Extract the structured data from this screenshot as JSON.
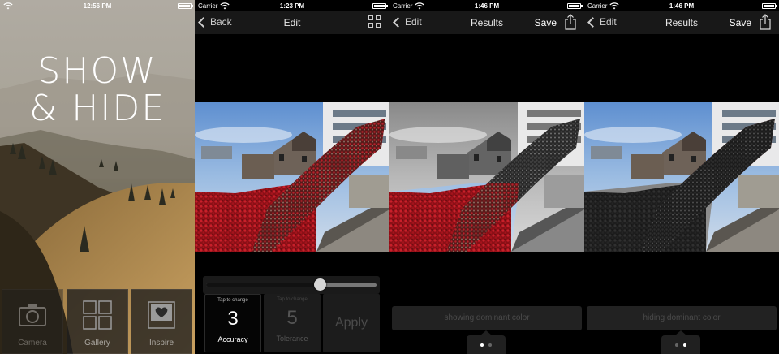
{
  "screens": {
    "home": {
      "status": {
        "carrier": "",
        "time": "12:56 PM"
      },
      "logo": {
        "line1": "SHOW",
        "line2": "& HIDE"
      },
      "tiles": [
        {
          "label": "Camera",
          "icon": "camera-icon"
        },
        {
          "label": "Gallery",
          "icon": "grid-icon"
        },
        {
          "label": "Inspire",
          "icon": "heart-photo-icon"
        }
      ]
    },
    "edit": {
      "status": {
        "carrier": "Carrier",
        "time": "1:23 PM"
      },
      "nav": {
        "back_label": "Back",
        "title": "Edit",
        "right_icon": "grid-icon"
      },
      "slider": {
        "value": 0.67
      },
      "controls": {
        "accuracy": {
          "hint": "Tap to change",
          "value": "3",
          "label": "Accuracy"
        },
        "tolerance": {
          "hint": "Tap to change",
          "value": "5",
          "label": "Tolerance"
        },
        "apply_label": "Apply"
      }
    },
    "results_show": {
      "status": {
        "carrier": "Carrier",
        "time": "1:46 PM"
      },
      "nav": {
        "back_label": "Edit",
        "title": "Results",
        "save_label": "Save",
        "right_icon": "share-icon"
      },
      "mode_label": "showing dominant color",
      "pager": {
        "count": 2,
        "active": 0
      }
    },
    "results_hide": {
      "status": {
        "carrier": "Carrier",
        "time": "1:46 PM"
      },
      "nav": {
        "back_label": "Edit",
        "title": "Results",
        "save_label": "Save",
        "right_icon": "share-icon"
      },
      "mode_label": "hiding dominant color",
      "pager": {
        "count": 2,
        "active": 1
      }
    }
  },
  "colors": {
    "poppy_red": "#b0141c",
    "nav_bg": "#181818",
    "panel_bg": "#1c1c1c"
  }
}
